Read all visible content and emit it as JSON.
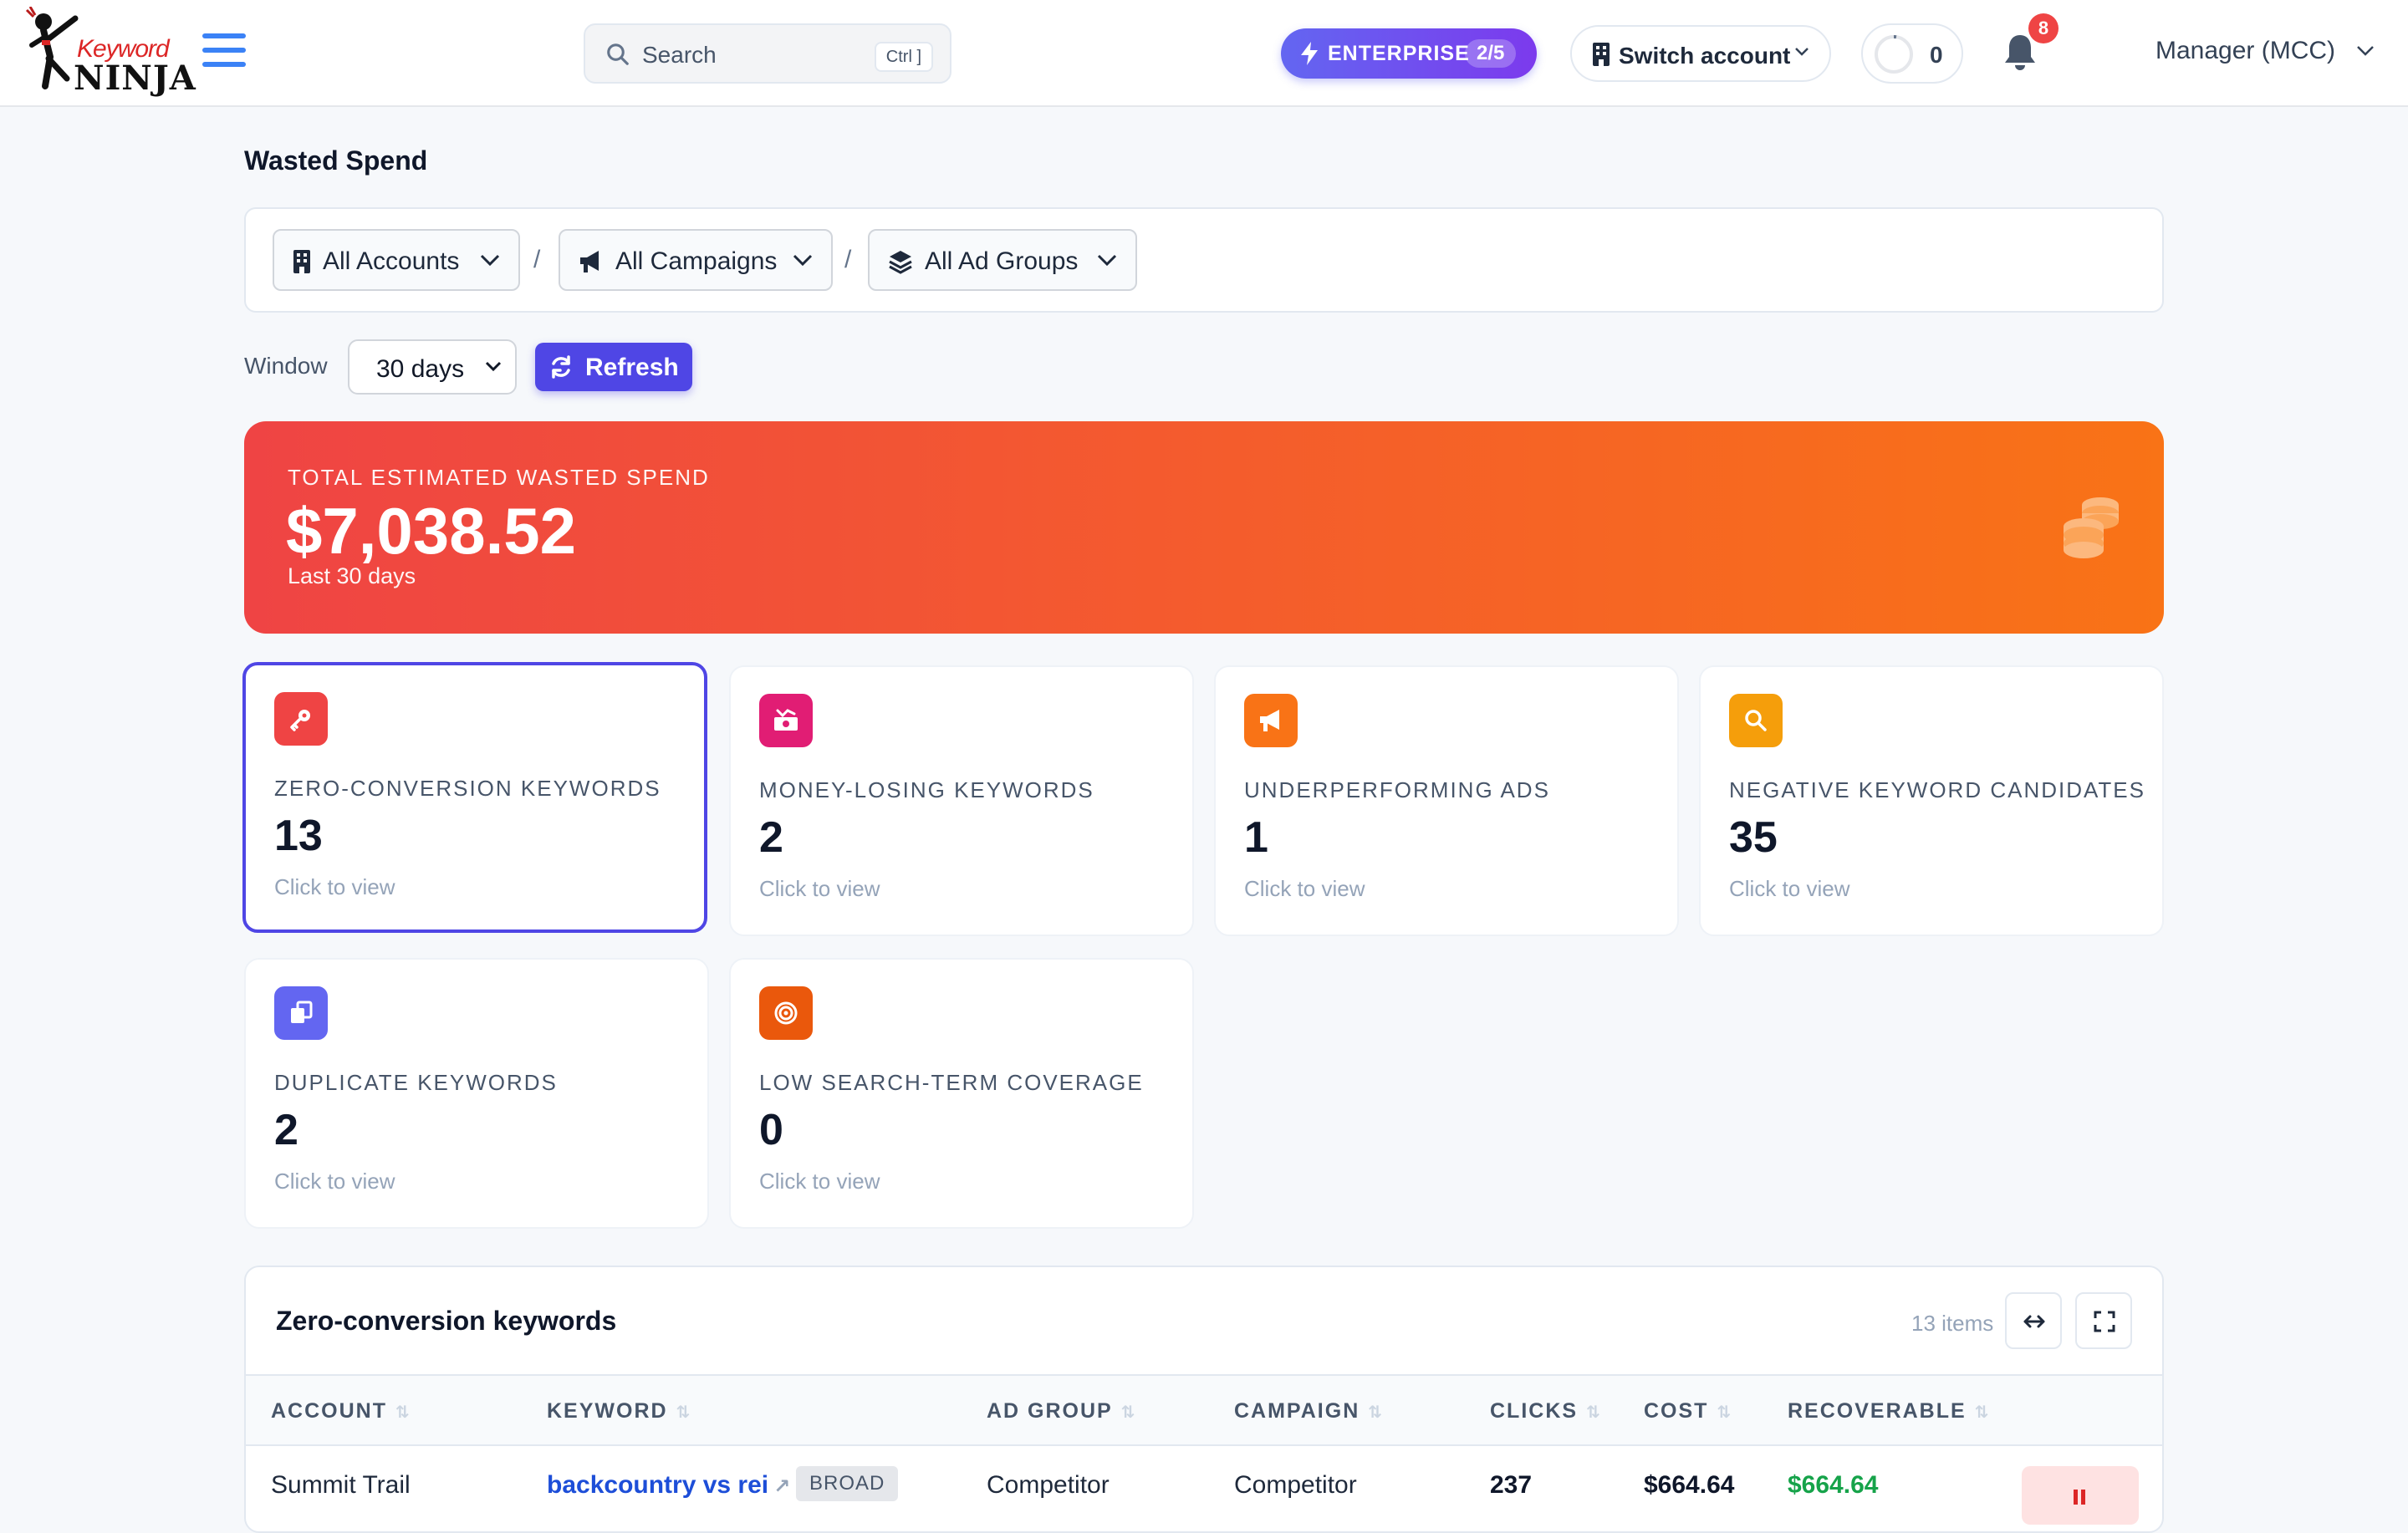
{
  "app": {
    "logo_word_top": "Keyword",
    "logo_word_bottom": "NINJA",
    "search_placeholder": "Search",
    "search_shortcut": "Ctrl ]",
    "plan_label": "ENTERPRISE",
    "plan_count": "2/5",
    "switch_account_label": "Switch account",
    "credits_value": "0",
    "notifications_count": "8",
    "account_menu_label": "Manager (MCC)"
  },
  "page": {
    "title": "Wasted Spend",
    "filters": {
      "accounts": "All Accounts",
      "campaigns": "All Campaigns",
      "ad_groups": "All Ad Groups",
      "separator": "/"
    },
    "window_label": "Window",
    "window_value": "30 days",
    "refresh_label": "Refresh"
  },
  "hero": {
    "label": "TOTAL ESTIMATED WASTED SPEND",
    "value": "$7,038.52",
    "sub": "Last 30 days"
  },
  "cards": [
    {
      "label": "ZERO-CONVERSION KEYWORDS",
      "value": "13",
      "cta": "Click to view",
      "icon": "key-icon",
      "color": "#ef4444"
    },
    {
      "label": "MONEY-LOSING KEYWORDS",
      "value": "2",
      "cta": "Click to view",
      "icon": "money-loss-icon",
      "color": "#e11d74"
    },
    {
      "label": "UNDERPERFORMING ADS",
      "value": "1",
      "cta": "Click to view",
      "icon": "megaphone-icon",
      "color": "#f97316"
    },
    {
      "label": "NEGATIVE KEYWORD CANDIDATES",
      "value": "35",
      "cta": "Click to view",
      "icon": "search-icon",
      "color": "#f59e0b"
    },
    {
      "label": "DUPLICATE KEYWORDS",
      "value": "2",
      "cta": "Click to view",
      "icon": "copy-icon",
      "color": "#6366f1"
    },
    {
      "label": "LOW SEARCH-TERM COVERAGE",
      "value": "0",
      "cta": "Click to view",
      "icon": "target-icon",
      "color": "#ea580c"
    }
  ],
  "table": {
    "title": "Zero-conversion keywords",
    "count": "13 items",
    "sort_glyph": "⇅",
    "columns": [
      "ACCOUNT",
      "KEYWORD",
      "AD GROUP",
      "CAMPAIGN",
      "CLICKS",
      "COST",
      "RECOVERABLE"
    ],
    "rows": [
      {
        "account": "Summit Trail",
        "keyword": "backcountry vs rei",
        "match": "BROAD",
        "ad_group": "Competitor",
        "campaign": "Competitor",
        "clicks": "237",
        "cost": "$664.64",
        "recoverable": "$664.64"
      }
    ]
  },
  "colors": {
    "accent": "#4f46e5",
    "hero_start": "#ef4444",
    "hero_end": "#f97316",
    "positive": "#16a34a"
  }
}
